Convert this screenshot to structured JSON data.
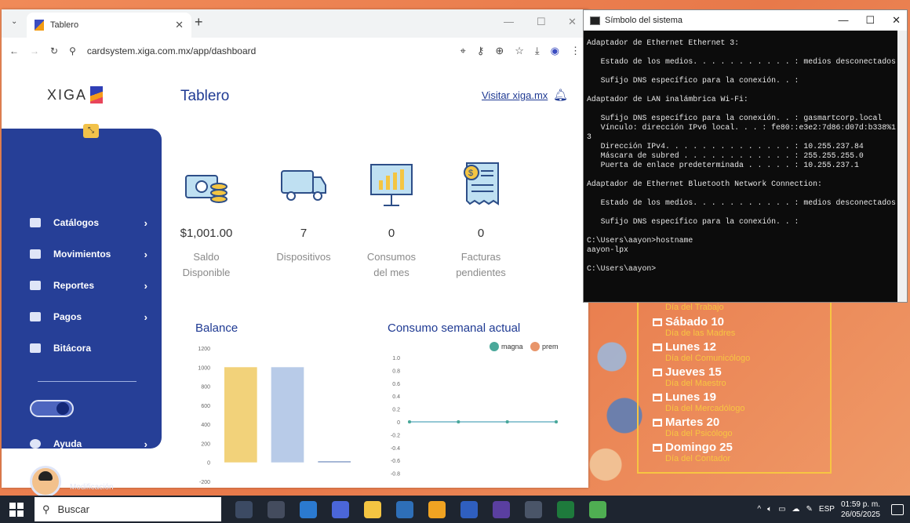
{
  "browser": {
    "tab_title": "Tablero",
    "url": "cardsystem.xiga.com.mx/app/dashboard"
  },
  "app": {
    "logo_text": "XIGA",
    "page_title": "Tablero",
    "visit_link": "Visitar xiga.mx"
  },
  "sidebar": {
    "items": [
      {
        "label": "Catálogos",
        "icon": "catalog-icon",
        "has_submenu": true
      },
      {
        "label": "Movimientos",
        "icon": "gear-icon",
        "has_submenu": true
      },
      {
        "label": "Reportes",
        "icon": "report-icon",
        "has_submenu": true
      },
      {
        "label": "Pagos",
        "icon": "payments-icon",
        "has_submenu": true
      },
      {
        "label": "Bitácora",
        "icon": "log-icon",
        "has_submenu": false
      }
    ],
    "help_label": "Ayuda",
    "user_name": "ALEXIA",
    "user_role": "Modificación"
  },
  "stats": [
    {
      "value": "$1,001.00",
      "label_1": "Saldo",
      "label_2": "Disponible",
      "icon": "money-icon"
    },
    {
      "value": "7",
      "label_1": "Dispositivos",
      "label_2": "",
      "icon": "truck-icon"
    },
    {
      "value": "0",
      "label_1": "Consumos",
      "label_2": "del mes",
      "icon": "presentation-chart-icon"
    },
    {
      "value": "0",
      "label_1": "Facturas",
      "label_2": "pendientes",
      "icon": "invoice-icon"
    }
  ],
  "chart_data": [
    {
      "type": "bar",
      "title": "Balance",
      "categories": [
        "",
        "",
        ""
      ],
      "values": [
        1000,
        1000,
        0
      ],
      "colors": [
        "#f2d27a",
        "#b8cbe8",
        "#8aa0c8"
      ],
      "yticks": [
        "1200",
        "1000",
        "800",
        "600",
        "400",
        "200",
        "0",
        "-200"
      ],
      "ylim": [
        -200,
        1200
      ]
    },
    {
      "type": "line",
      "title": "Consumo semanal actual",
      "legend": [
        "magna",
        "prem"
      ],
      "legend_colors": [
        "#4aa89a",
        "#e8956a"
      ],
      "yticks": [
        "1.0",
        "0.8",
        "0.6",
        "0.4",
        "0.2",
        "0",
        "-0.2",
        "-0.4",
        "-0.6",
        "-0.8"
      ],
      "ylim": [
        -0.8,
        1.0
      ],
      "series": [
        {
          "name": "magna",
          "values": [
            0,
            0,
            0,
            0
          ]
        },
        {
          "name": "prem",
          "values": [
            0,
            0,
            0,
            0
          ]
        }
      ]
    }
  ],
  "cmd": {
    "title": "Símbolo del sistema",
    "lines": [
      "Adaptador de Ethernet Ethernet 3:",
      "",
      "   Estado de los medios. . . . . . . . . . . : medios desconectados",
      "",
      "   Sufijo DNS específico para la conexión. . :",
      "",
      "Adaptador de LAN inalámbrica Wi-Fi:",
      "",
      "   Sufijo DNS específico para la conexión. . : gasmartcorp.local",
      "   Vínculo: dirección IPv6 local. . . : fe80::e3e2:7d86:d07d:b338%1",
      "3",
      "   Dirección IPv4. . . . . . . . . . . . . . : 10.255.237.84",
      "   Máscara de subred . . . . . . . . . . . . : 255.255.255.0",
      "   Puerta de enlace predeterminada . . . . . : 10.255.237.1",
      "",
      "Adaptador de Ethernet Bluetooth Network Connection:",
      "",
      "   Estado de los medios. . . . . . . . . . . : medios desconectados",
      "",
      "   Sufijo DNS específico para la conexión. . :",
      "",
      "C:\\Users\\aayon>hostname",
      "aayon-lpx",
      "",
      "C:\\Users\\aayon>"
    ]
  },
  "calendar": {
    "top_note": "Día del Trabajo",
    "entries": [
      {
        "day": "Sábado 10",
        "note": "Día de las Madres"
      },
      {
        "day": "Lunes 12",
        "note": "Día del Comunicólogo"
      },
      {
        "day": "Jueves 15",
        "note": "Día del Maestro"
      },
      {
        "day": "Lunes 19",
        "note": "Día del Mercadólogo"
      },
      {
        "day": "Martes 20",
        "note": "Día del Psicólogo"
      },
      {
        "day": "Domingo 25",
        "note": "Día del Contador"
      }
    ]
  },
  "taskbar": {
    "search_placeholder": "Buscar",
    "lang": "ESP",
    "time": "01:59 p. m.",
    "date": "26/05/2025",
    "app_colors": [
      "#3c4a63",
      "#444c5e",
      "#2b7ad0",
      "#4b66d8",
      "#f4c542",
      "#2e6fb8",
      "#f0a322",
      "#2f5fbf",
      "#5a3fa0",
      "#4a5568",
      "#1e7a3c",
      "#4fae52"
    ]
  }
}
